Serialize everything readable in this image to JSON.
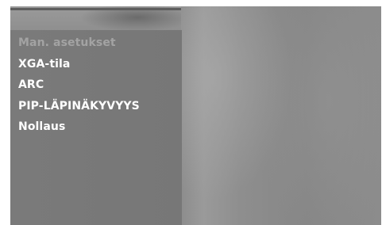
{
  "menu": {
    "items": [
      {
        "label": "Man. asetukset",
        "state": "disabled"
      },
      {
        "label": "XGA-tila",
        "state": "enabled"
      },
      {
        "label": "ARC",
        "state": "enabled"
      },
      {
        "label": "PIP-LÄPINÄKYVYYS",
        "state": "enabled"
      },
      {
        "label": "Nollaus",
        "state": "enabled"
      }
    ]
  },
  "colors": {
    "panel": "#787878",
    "enabled_text": "#ffffff",
    "disabled_text": "#a3a3a3"
  }
}
